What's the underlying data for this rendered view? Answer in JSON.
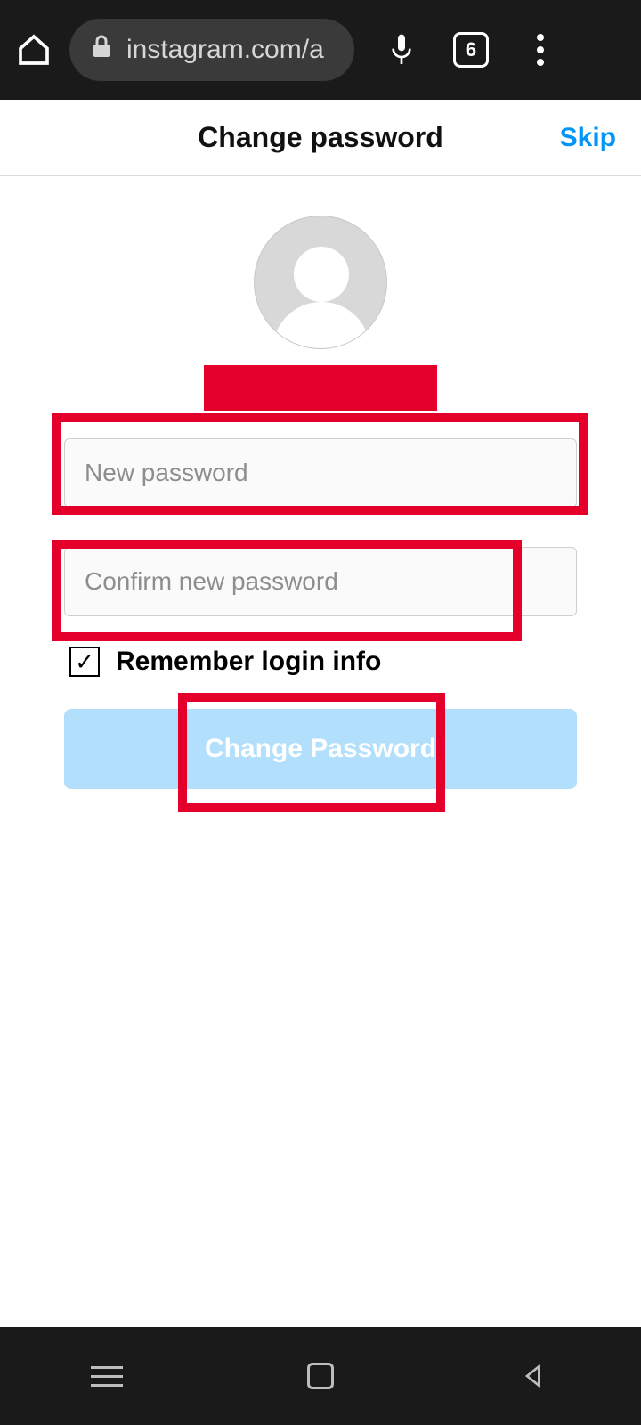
{
  "chrome": {
    "url_text": "instagram.com/a",
    "tab_count": "6"
  },
  "header": {
    "title": "Change password",
    "skip": "Skip"
  },
  "form": {
    "new_password_placeholder": "New password",
    "confirm_password_placeholder": "Confirm new password",
    "remember_label": "Remember login info",
    "remember_checked": "✓",
    "submit_label": "Change Password"
  }
}
